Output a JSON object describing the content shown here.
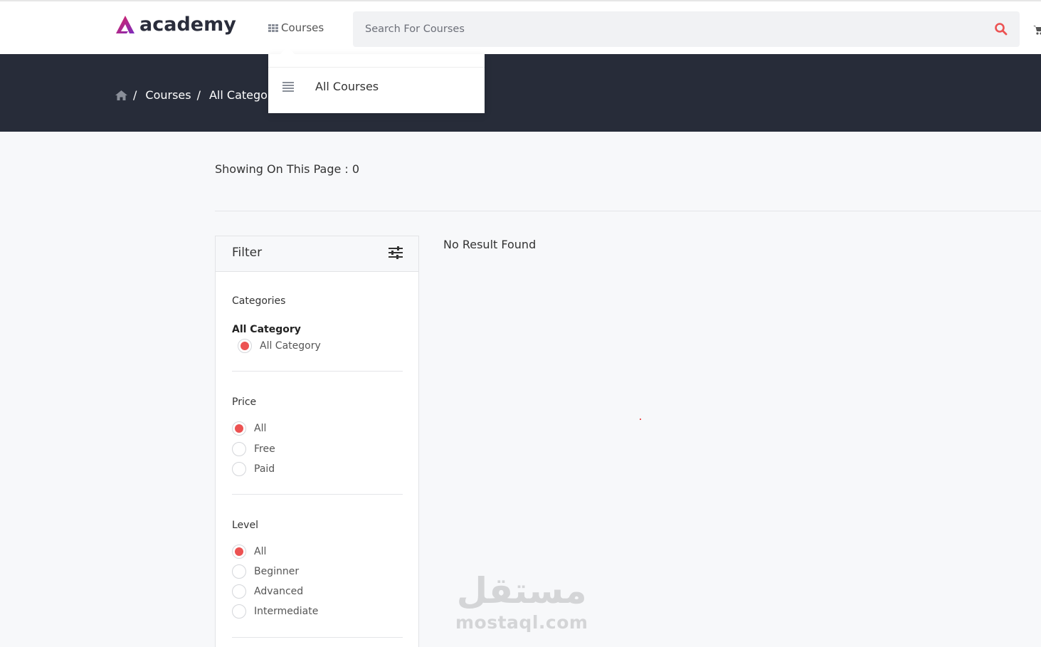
{
  "header": {
    "logo_text": "academy",
    "courses_label": "Courses",
    "search_placeholder": "Search For Courses"
  },
  "breadcrumb": {
    "items": [
      "Courses",
      "All Catego"
    ]
  },
  "dropdown": {
    "items": [
      {
        "label": "All Courses",
        "icon": "list-icon"
      }
    ]
  },
  "main": {
    "showing_text": "Showing On This Page : 0",
    "no_result_text": "No Result Found"
  },
  "filter": {
    "title": "Filter",
    "categories": {
      "label": "Categories",
      "group_label": "All Category",
      "options": [
        {
          "label": "All Category",
          "checked": true
        }
      ]
    },
    "price": {
      "label": "Price",
      "options": [
        {
          "label": "All",
          "checked": true
        },
        {
          "label": "Free",
          "checked": false
        },
        {
          "label": "Paid",
          "checked": false
        }
      ]
    },
    "level": {
      "label": "Level",
      "options": [
        {
          "label": "All",
          "checked": true
        },
        {
          "label": "Beginner",
          "checked": false
        },
        {
          "label": "Advanced",
          "checked": false
        },
        {
          "label": "Intermediate",
          "checked": false
        }
      ]
    }
  },
  "watermark": {
    "arabic": "مستقل",
    "latin": "mostaql.com"
  },
  "colors": {
    "accent": "#ec5252",
    "banner": "#272c39",
    "logo": "#c2185b"
  }
}
